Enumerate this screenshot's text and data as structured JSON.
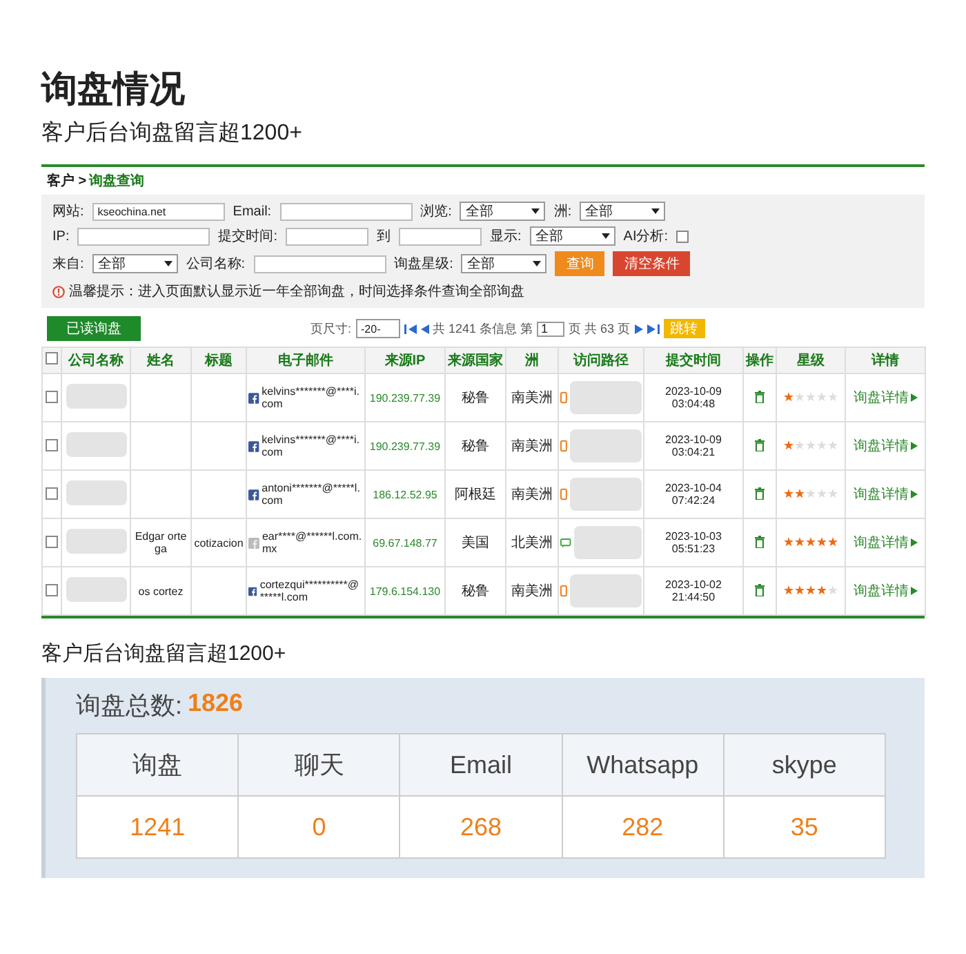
{
  "heading": {
    "title": "询盘情况",
    "subtitle": "客户后台询盘留言超1200+"
  },
  "panel": {
    "breadcrumb_parent": "客户 >",
    "breadcrumb_current": "询盘查询",
    "filter_rows": [
      [
        {
          "kind": "text",
          "label": "网站:",
          "value": "kseochina.net"
        },
        {
          "kind": "text",
          "label": "Email:"
        },
        {
          "kind": "select",
          "label": "浏览:",
          "value": "全部"
        },
        {
          "kind": "select",
          "label": "洲:",
          "value": "全部"
        }
      ],
      [
        {
          "kind": "text",
          "label": "IP:"
        },
        {
          "kind": "range",
          "label": "提交时间:",
          "separator": "到"
        },
        {
          "kind": "select",
          "label": "显示:",
          "value": "全部"
        },
        {
          "kind": "checkbox",
          "label": "AI分析:",
          "checked": false
        }
      ],
      [
        {
          "kind": "select",
          "label": "来自:",
          "value": "全部"
        },
        {
          "kind": "text",
          "label": "公司名称:"
        },
        {
          "kind": "select",
          "label": "询盘星级:",
          "value": "全部"
        },
        {
          "kind": "query",
          "label": "查询"
        },
        {
          "kind": "clear",
          "label": "清空条件"
        }
      ]
    ],
    "hint": "温馨提示：进入页面默认显示近一年全部询盘，时间选择条件查询全部询盘",
    "read_button": "已读询盘",
    "pager": {
      "size_label": "页尺寸:",
      "size_value": "-20-",
      "total_text": "共 1241 条信息 第",
      "page_value": "1",
      "pages_text": "页 共 63 页",
      "jump": "跳转"
    },
    "table": {
      "select_all_checked": false,
      "columns": [
        "公司名称",
        "姓名",
        "标题",
        "电子邮件",
        "来源IP",
        "来源国家",
        "洲",
        "访问路径",
        "提交时间",
        "操作",
        "星级",
        "详情"
      ],
      "rows": [
        {
          "checked": false,
          "facebook_linked": true,
          "email": "kelvins*******@****i.com",
          "ip": "190.239.77.39",
          "country": "秘鲁",
          "continent": "南美洲",
          "mobile": true,
          "time": "2023-10-09 03:04:48",
          "stars": 1,
          "detail": "询盘详情"
        },
        {
          "checked": false,
          "facebook_linked": true,
          "email": "kelvins*******@****i.com",
          "ip": "190.239.77.39",
          "country": "秘鲁",
          "continent": "南美洲",
          "mobile": true,
          "time": "2023-10-09 03:04:21",
          "stars": 1,
          "detail": "询盘详情"
        },
        {
          "checked": false,
          "facebook_linked": true,
          "email": "antoni*******@*****l.com",
          "ip": "186.12.52.95",
          "country": "阿根廷",
          "continent": "南美洲",
          "mobile": true,
          "time": "2023-10-04 07:42:24",
          "stars": 2,
          "detail": "询盘详情"
        },
        {
          "checked": false,
          "name": "Edgar ortega",
          "title": "cotizacion",
          "facebook_linked": false,
          "email": "ear****@******l.com.mx",
          "ip": "69.67.148.77",
          "country": "美国",
          "continent": "北美洲",
          "mobile": false,
          "time": "2023-10-03 05:51:23",
          "stars": 5,
          "detail": "询盘详情"
        },
        {
          "checked": false,
          "name": "os cortez",
          "facebook_linked": true,
          "email": "cortezqui**********@*****l.com",
          "ip": "179.6.154.130",
          "country": "秘鲁",
          "continent": "南美洲",
          "mobile": true,
          "time": "2023-10-02 21:44:50",
          "stars": 4,
          "detail": "询盘详情"
        }
      ]
    }
  },
  "caption": "客户后台询盘留言超1200+",
  "stats": {
    "label": "询盘总数:",
    "total": "1826",
    "columns": [
      {
        "header": "询盘",
        "value": "1241"
      },
      {
        "header": "聊天",
        "value": "0"
      },
      {
        "header": "Email",
        "value": "268"
      },
      {
        "header": "Whatsapp",
        "value": "282"
      },
      {
        "header": "skype",
        "value": "35"
      }
    ]
  }
}
